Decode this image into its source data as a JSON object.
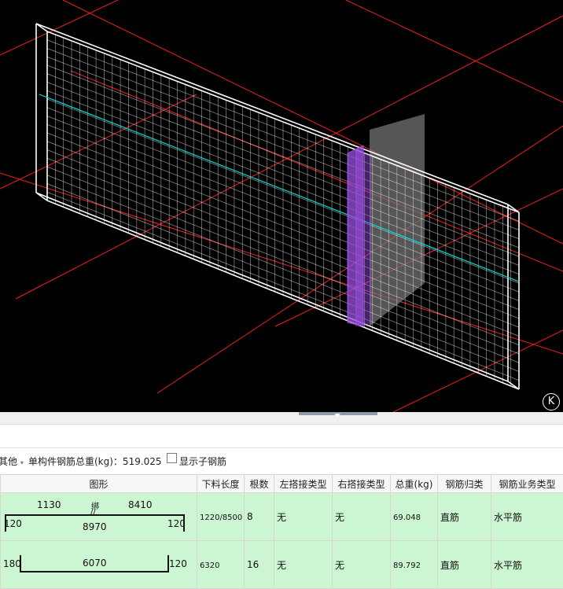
{
  "viewport": {
    "axis_badge": "K"
  },
  "toolbar": {
    "left_clipped_label": "其他",
    "total_weight_label": "单构件钢筋总重(kg)：519.025",
    "show_sub_rebar_label": "显示子钢筋"
  },
  "table": {
    "headers": [
      "图形",
      "下料长度",
      "根数",
      "左搭接类型",
      "右搭接类型",
      "总重(kg)",
      "钢筋归类",
      "钢筋业务类型"
    ],
    "rows": [
      {
        "shape": {
          "top_left": "1130",
          "mid_mark": "绑",
          "top_right": "8410",
          "left_end": "120",
          "middle": "8970",
          "right_end": "120"
        },
        "cut_length": "1220/8500",
        "count": "8",
        "left_lap": "无",
        "right_lap": "无",
        "weight": "69.048",
        "category": "直筋",
        "business_type": "水平筋"
      },
      {
        "shape": {
          "left_end": "180",
          "middle": "6070",
          "right_end": "120"
        },
        "cut_length": "6320",
        "count": "16",
        "left_lap": "无",
        "right_lap": "无",
        "weight": "89.792",
        "category": "直筋",
        "business_type": "水平筋"
      }
    ]
  },
  "colors": {
    "viewport_bg": "#000000",
    "row_bg": "#ccf5d2",
    "wire": "#ffffff",
    "axis": "#ff2020",
    "centerline": "#00e0e0",
    "highlight": "#9a4fe0"
  }
}
